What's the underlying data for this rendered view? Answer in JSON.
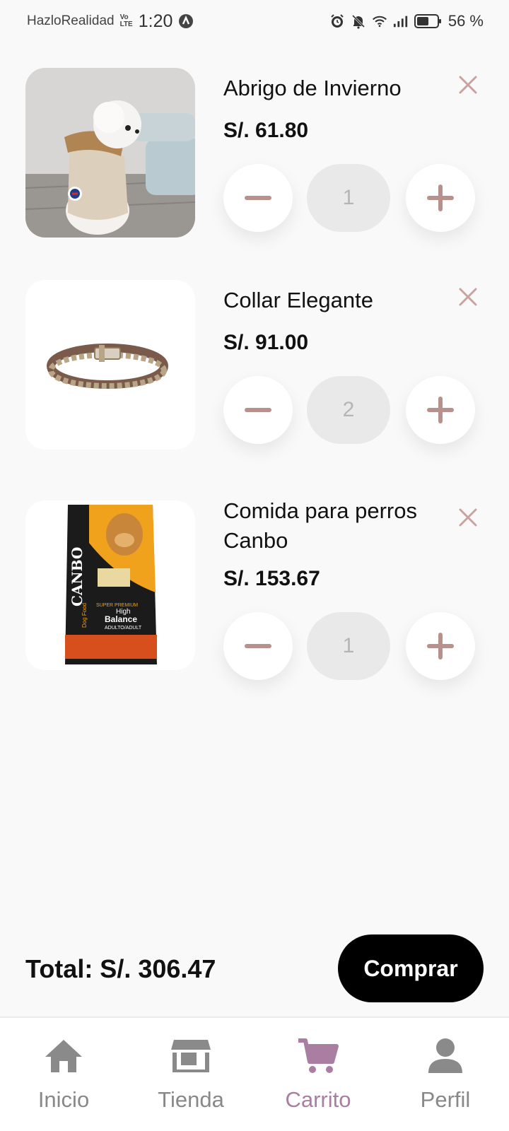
{
  "status_bar": {
    "carrier": "HazloRealidad",
    "volte_top": "Vo",
    "volte_bottom": "LTE",
    "time": "1:20",
    "battery": "56 %"
  },
  "cart": {
    "items": [
      {
        "name": "Abrigo de Invierno",
        "price": "S/. 61.80",
        "quantity": "1",
        "image": "dog-coat-photo"
      },
      {
        "name": "Collar Elegante",
        "price": "S/. 91.00",
        "quantity": "2",
        "image": "chain-collar-photo"
      },
      {
        "name": "Comida para perros Canbo",
        "price": "S/. 153.67",
        "quantity": "1",
        "image": "dog-food-bag-photo",
        "package_text": {
          "brand": "CANBO",
          "line1": "SUPER PREMIUM",
          "line2": "High",
          "line3": "Balance",
          "line4": "ADULTO/ADULT",
          "side": "Dog Food"
        }
      }
    ],
    "total_label": "Total: S/. 306.47",
    "buy_label": "Comprar"
  },
  "nav": {
    "items": [
      {
        "label": "Inicio",
        "icon": "home-icon"
      },
      {
        "label": "Tienda",
        "icon": "store-icon"
      },
      {
        "label": "Carrito",
        "icon": "cart-icon",
        "active": true
      },
      {
        "label": "Perfil",
        "icon": "user-icon"
      }
    ]
  },
  "colors": {
    "accent": "#a97ea1",
    "qty_icon": "#b8908c",
    "remove_icon": "#c9a39f",
    "background": "#f9f9f9",
    "buy_button": "#000000"
  }
}
